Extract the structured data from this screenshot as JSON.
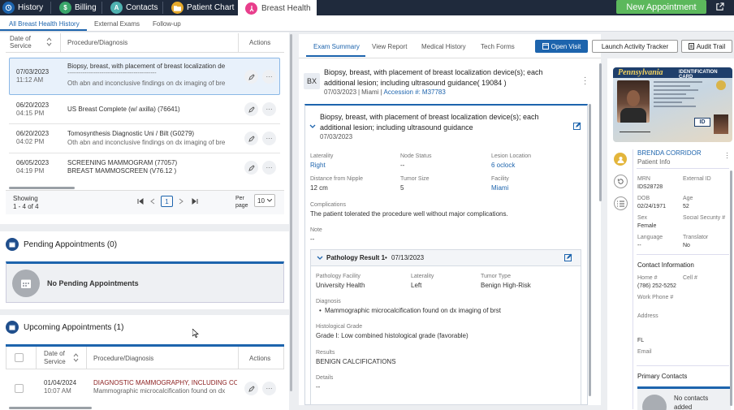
{
  "top_nav": {
    "history": "History",
    "billing": "Billing",
    "contacts": "Contacts",
    "patient_chart": "Patient Chart",
    "breast_health": "Breast Health",
    "new_appointment": "New Appointment",
    "billing_icon": "$",
    "contacts_icon": "A"
  },
  "sub_tabs": [
    "All Breast Health History",
    "External Exams",
    "Follow-up"
  ],
  "history_table": {
    "headers": {
      "date": "Date of Service",
      "procedure": "Procedure/Diagnosis",
      "actions": "Actions"
    },
    "rows": [
      {
        "date": "07/03/2023",
        "time": "11:12 AM",
        "line1": "Biopsy, breast, with placement of breast localization de",
        "divider": "-----------------------------------------------",
        "line2": "Oth abn and inconclusive findings on dx imaging of bre"
      },
      {
        "date": "06/20/2023",
        "time": "04:15 PM",
        "line1": "US Breast Complete (w/ axilla) (76641)",
        "divider": "",
        "line2": ""
      },
      {
        "date": "06/20/2023",
        "time": "04:02 PM",
        "line1": "Tomosynthesis Diagnostic Uni / Bilt (G0279)",
        "divider": "",
        "line2": "Oth abn and inconclusive findings on dx imaging of bre"
      },
      {
        "date": "06/05/2023",
        "time": "04:19 PM",
        "line1": "SCREENING MAMMOGRAM (77057)",
        "divider": "",
        "line2": "BREAST MAMMOSCREEN (V76.12 )"
      }
    ],
    "showing_label": "Showing",
    "showing_range": "1 - 4 of 4",
    "page_number": "1",
    "per_page_label": "Per page",
    "per_page_value": "10"
  },
  "pending": {
    "title": "Pending Appointments (0)",
    "empty_text": "No Pending Appointments"
  },
  "upcoming": {
    "title": "Upcoming Appointments (1)",
    "headers": {
      "date": "Date of Service",
      "procedure": "Procedure/Diagnosis",
      "actions": "Actions"
    },
    "rows": [
      {
        "date": "01/04/2024",
        "time": "10:07 AM",
        "line1": "DIAGNOSTIC MAMMOGRAPHY, INCLUDING CO",
        "line2": "Mammographic microcalcification found on dx"
      }
    ]
  },
  "exam_tabs": [
    "Exam Summary",
    "View Report",
    "Medical History",
    "Tech Forms"
  ],
  "buttons": {
    "open_visit": "Open Visit",
    "launch_tracker": "Launch Activity Tracker",
    "audit_trail": "Audit Trail"
  },
  "exam": {
    "badge": "BX",
    "title": "Biopsy, breast, with placement of breast localization device(s); each additional lesion; including ultrasound guidance( 19084 )",
    "date": "07/03/2023",
    "location": "Miami",
    "accession_label": "Accession #:",
    "accession": "M37783",
    "card_title": "Biopsy, breast, with placement of breast localization device(s); each additional lesion; including ultrasound guidance",
    "card_date": "07/03/2023",
    "fields": [
      {
        "label": "Laterality",
        "value": "Right"
      },
      {
        "label": "Node Status",
        "value": "--"
      },
      {
        "label": "Lesion Location",
        "value": "6 oclock"
      },
      {
        "label": "Distance from Nipple",
        "value": "12 cm"
      },
      {
        "label": "Tumor Size",
        "value": "5"
      },
      {
        "label": "Facility",
        "value": "Miami"
      }
    ],
    "complications_label": "Complications",
    "complications": "The patient tolerated the procedure well without major complications.",
    "note_label": "Note",
    "note": "--"
  },
  "pathology": {
    "title": "Pathology Result 1",
    "date": "07/13/2023",
    "facility_label": "Pathology Facility",
    "facility": "University Health",
    "laterality_label": "Laterality",
    "laterality": "Left",
    "tumor_type_label": "Tumor Type",
    "tumor_type": "Benign High-Risk",
    "diagnosis_label": "Diagnosis",
    "diagnosis": "Mammographic microcalcification found on dx imaging of brst",
    "grade_label": "Histological Grade",
    "grade": "Grade I: Low combined histological grade (favorable)",
    "results_label": "Results",
    "results": "BENIGN CALCIFICATIONS",
    "details_label": "Details",
    "details": "--"
  },
  "patient": {
    "id_card_state": "Pennsylvania",
    "id_card_label": "IDENTIFICATION CARD",
    "id_card_badge": "ID",
    "name": "BRENDA CORRIDOR",
    "subtitle": "Patient Info",
    "mrn_label": "MRN",
    "mrn": "IDS28728",
    "external_id_label": "External ID",
    "external_id": "",
    "dob_label": "DOB",
    "dob": "02/24/1971",
    "age_label": "Age",
    "age": "52",
    "sex_label": "Sex",
    "sex": "Female",
    "ssn_label": "Social Security #",
    "ssn": "",
    "language_label": "Language",
    "language": "--",
    "translator_label": "Translator",
    "translator": "No",
    "contact_title": "Contact Information",
    "home_label": "Home #",
    "home": "(786) 252-5252",
    "cell_label": "Cell #",
    "cell": "",
    "work_label": "Work Phone #",
    "address_label": "Address",
    "state": "FL",
    "email_label": "Email",
    "primary_contacts_title": "Primary Contacts",
    "no_contacts": "No contacts added"
  },
  "colors": {
    "nav_bg": "#1f2a3c",
    "accent": "#1d64ad",
    "green": "#5cb85c",
    "pink": "#e83e8c"
  }
}
